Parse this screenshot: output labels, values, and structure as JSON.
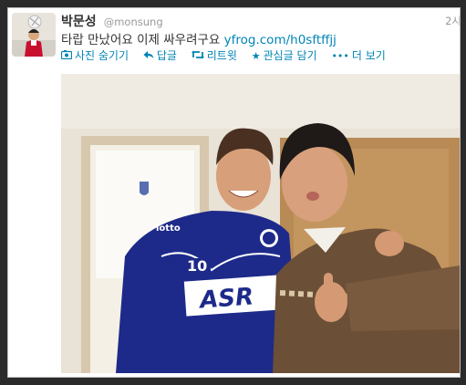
{
  "tweet": {
    "display_name": "박문성",
    "handle": "@monsung",
    "time": "2시",
    "text": "타랍 만났어요 이제 싸우려구요",
    "link": "yfrog.com/h0sftffjj"
  },
  "actions": [
    {
      "icon": "photo-icon",
      "label": "사진 숨기기"
    },
    {
      "icon": "reply-icon",
      "label": "답글"
    },
    {
      "icon": "retweet-icon",
      "label": "리트윗"
    },
    {
      "icon": "star-icon",
      "label": "관심글 담기"
    },
    {
      "icon": "more-icon",
      "label": "더 보기"
    }
  ],
  "photo": {
    "jersey_number": "10",
    "sponsor": "ASR",
    "kit_brand": "lotto"
  },
  "colors": {
    "link": "#0084b4",
    "jersey": "#1d2a8a"
  }
}
